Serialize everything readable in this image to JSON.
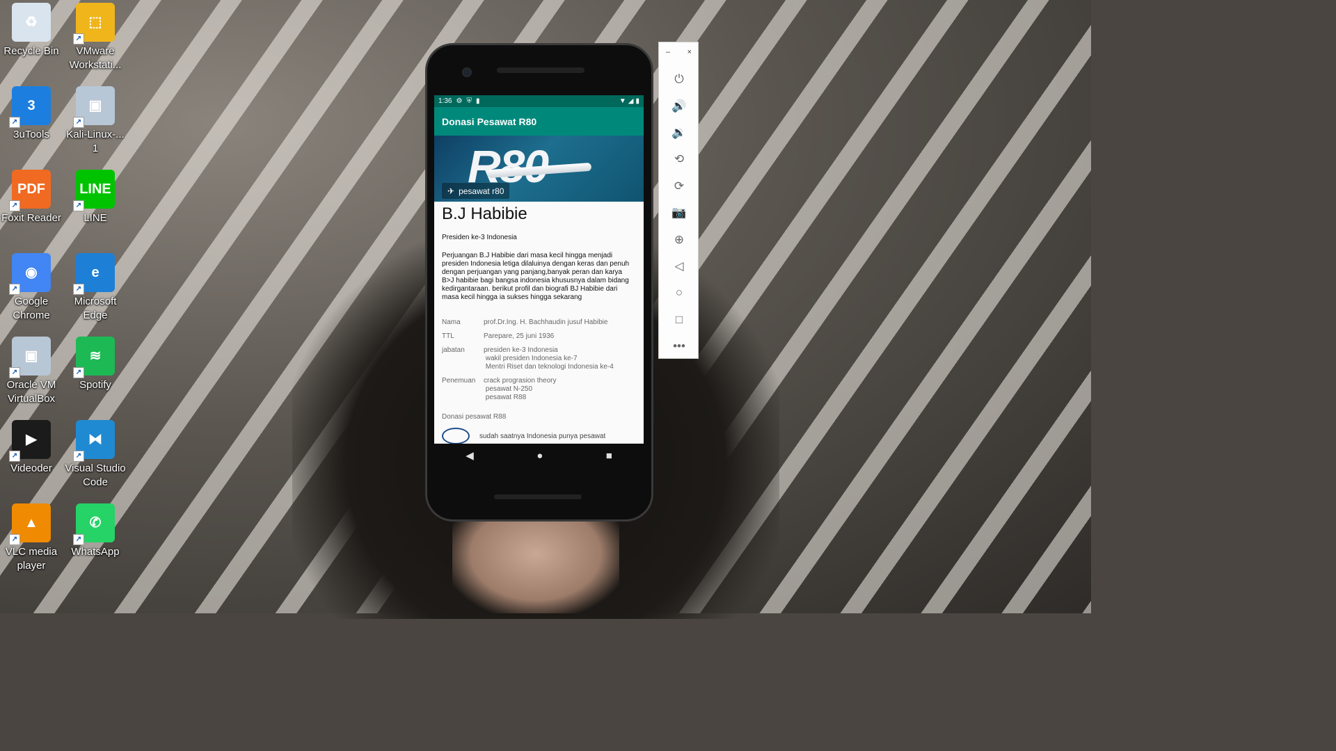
{
  "desktop": {
    "icons": [
      {
        "label": "Recycle Bin",
        "glyph": "♻",
        "color": "#d9e4ee"
      },
      {
        "label": "VMware Workstati...",
        "glyph": "⬚",
        "color": "#f1b51c"
      },
      {
        "label": "3uTools",
        "glyph": "3",
        "color": "#1c7fe0"
      },
      {
        "label": "Kali-Linux-... 1",
        "glyph": "▣",
        "color": "#b8c7d6"
      },
      {
        "label": "Foxit Reader",
        "glyph": "PDF",
        "color": "#f06a22"
      },
      {
        "label": "LINE",
        "glyph": "LINE",
        "color": "#00c300"
      },
      {
        "label": "Google Chrome",
        "glyph": "◉",
        "color": "#4285f4"
      },
      {
        "label": "Microsoft Edge",
        "glyph": "e",
        "color": "#1e7fd6"
      },
      {
        "label": "Oracle VM VirtualBox",
        "glyph": "▣",
        "color": "#b8c7d6"
      },
      {
        "label": "Spotify",
        "glyph": "≋",
        "color": "#1db954"
      },
      {
        "label": "Videoder",
        "glyph": "▶",
        "color": "#1b1b1b"
      },
      {
        "label": "Visual Studio Code",
        "glyph": "⧓",
        "color": "#1f8ad2"
      },
      {
        "label": "VLC media player",
        "glyph": "▲",
        "color": "#f08a00"
      },
      {
        "label": "WhatsApp",
        "glyph": "✆",
        "color": "#25d366"
      }
    ]
  },
  "phone": {
    "status": {
      "time": "1:36",
      "icons": [
        "gear-icon",
        "shield-icon",
        "sdcard-icon"
      ],
      "right_icons": [
        "wifi-icon",
        "signal-icon",
        "battery-icon"
      ]
    },
    "appbar_title": "Donasi Pesawat R80",
    "banner": {
      "logo_text": "R80",
      "chip_label": "pesawat r80"
    },
    "name": "B.J Habibie",
    "subtitle": "Presiden ke-3 Indonesia",
    "description": "Perjuangan B.J Habibie dari masa kecil hingga menjadi presiden Indonesia letiga dilaluinya dengan keras dan penuh dengan perjuangan yang panjang,banyak peran dan karya B>J habibie bagi bangsa indonesia khususnya dalam bidang kedirgantaraan. berikut profil dan biografi BJ Habibie dari masa kecil hingga ia sukses hingga sekarang",
    "profile": [
      {
        "key": "Nama",
        "value": "prof.Dr.Ing. H. Bachhaudin jusuf Habibie"
      },
      {
        "key": "TTL",
        "value": "Parepare, 25 juni 1936"
      },
      {
        "key": "jabatan",
        "value": "presiden ke-3 Indonesia\n wakil presiden Indonesia ke-7\n Mentri Riset dan teknologi Indonesia ke-4"
      },
      {
        "key": "Penemuan",
        "value": "crack prograsion theory\n pesawat N-250\n pesawat R88"
      }
    ],
    "donasi_title": "Donasi pesawat R88",
    "donasi_item_text": "sudah saatnya Indonesia punya pesawat",
    "nav": {
      "back": "◀",
      "home": "●",
      "recents": "■"
    }
  },
  "toolbar": {
    "minimize": "–",
    "close": "×",
    "buttons": [
      {
        "name": "power-icon",
        "glyph": "⏻"
      },
      {
        "name": "volume-up-icon",
        "glyph": "🔊"
      },
      {
        "name": "volume-down-icon",
        "glyph": "🔉"
      },
      {
        "name": "rotate-left-icon",
        "glyph": "⟲"
      },
      {
        "name": "rotate-right-icon",
        "glyph": "⟳"
      },
      {
        "name": "camera-icon",
        "glyph": "📷"
      },
      {
        "name": "zoom-icon",
        "glyph": "⊕"
      },
      {
        "name": "back-icon",
        "glyph": "◁"
      },
      {
        "name": "home-icon",
        "glyph": "○"
      },
      {
        "name": "overview-icon",
        "glyph": "□"
      },
      {
        "name": "more-icon",
        "glyph": "•••"
      }
    ]
  }
}
